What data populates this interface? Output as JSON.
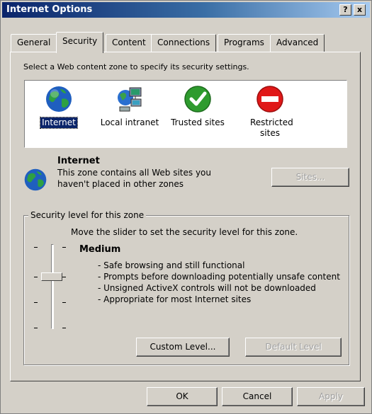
{
  "window": {
    "title": "Internet Options",
    "help_glyph": "?",
    "close_glyph": "x"
  },
  "tabs": [
    {
      "label": "General",
      "active": false
    },
    {
      "label": "Security",
      "active": true
    },
    {
      "label": "Content",
      "active": false
    },
    {
      "label": "Connections",
      "active": false
    },
    {
      "label": "Programs",
      "active": false
    },
    {
      "label": "Advanced",
      "active": false
    }
  ],
  "security": {
    "instruction": "Select a Web content zone to specify its security settings.",
    "zones": [
      {
        "label": "Internet",
        "icon": "globe-icon",
        "selected": true
      },
      {
        "label": "Local intranet",
        "icon": "network-computer-icon",
        "selected": false
      },
      {
        "label": "Trusted sites",
        "icon": "checkmark-icon",
        "selected": false
      },
      {
        "label": "Restricted sites",
        "icon": "restricted-icon",
        "selected": false
      }
    ],
    "selected_zone": {
      "name": "Internet",
      "description_line1": "This zone contains all Web sites you",
      "description_line2": "haven't placed in other zones"
    },
    "sites_button": "Sites...",
    "level_group_title": "Security level for this zone",
    "slider_hint": "Move the slider to set the security level for this zone.",
    "level_name": "Medium",
    "level_index": 2,
    "level_count": 4,
    "level_bullets": [
      "- Safe browsing and still functional",
      "- Prompts before downloading potentially unsafe content",
      "- Unsigned ActiveX controls will not be downloaded",
      "- Appropriate for most Internet sites"
    ],
    "custom_level_button": "Custom Level...",
    "default_level_button": "Default Level"
  },
  "footer": {
    "ok": "OK",
    "cancel": "Cancel",
    "apply": "Apply"
  },
  "colors": {
    "face": "#d4d0c8",
    "title_active": "#0a246a",
    "selection": "#0a246a",
    "trusted_green": "#2e9b2e",
    "restricted_red": "#e01818"
  }
}
